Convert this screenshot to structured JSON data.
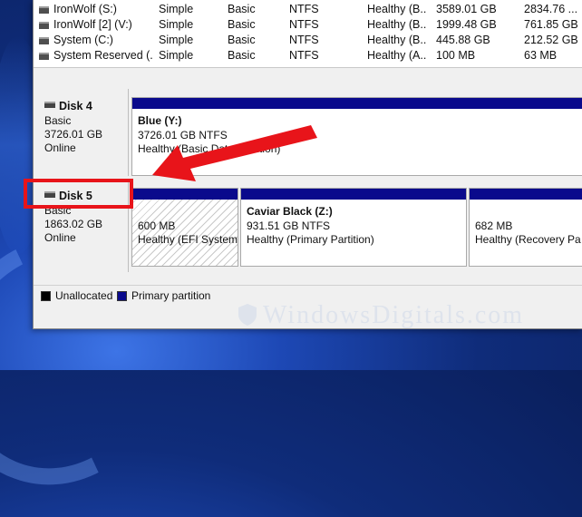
{
  "volumes": [
    {
      "name": "IronWolf (S:)",
      "layout": "Simple",
      "type": "Basic",
      "fs": "NTFS",
      "status": "Healthy (B...",
      "capacity": "3589.01 GB",
      "free": "2834.76 ..."
    },
    {
      "name": "IronWolf [2] (V:)",
      "layout": "Simple",
      "type": "Basic",
      "fs": "NTFS",
      "status": "Healthy (B...",
      "capacity": "1999.48 GB",
      "free": "761.85 GB"
    },
    {
      "name": "System (C:)",
      "layout": "Simple",
      "type": "Basic",
      "fs": "NTFS",
      "status": "Healthy (B...",
      "capacity": "445.88 GB",
      "free": "212.52 GB"
    },
    {
      "name": "System Reserved (...",
      "layout": "Simple",
      "type": "Basic",
      "fs": "NTFS",
      "status": "Healthy (A...",
      "capacity": "100 MB",
      "free": "63 MB"
    }
  ],
  "disks": [
    {
      "title": "Disk 4",
      "type": "Basic",
      "size": "3726.01 GB",
      "status": "Online",
      "partitions": [
        {
          "label": "Blue  (Y:)",
          "size": "3726.01 GB NTFS",
          "status": "Healthy (Basic Data Partition)"
        }
      ]
    },
    {
      "title": "Disk 5",
      "type": "Basic",
      "size": "1863.02 GB",
      "status": "Online",
      "partitions": [
        {
          "label": "",
          "size": "600 MB",
          "status": "Healthy (EFI System"
        },
        {
          "label": "Caviar Black  (Z:)",
          "size": "931.51 GB NTFS",
          "status": "Healthy (Primary Partition)"
        },
        {
          "label": "",
          "size": "682 MB",
          "status": "Healthy (Recovery Pa"
        }
      ]
    }
  ],
  "legend": {
    "unallocated": "Unallocated",
    "primary": "Primary partition"
  },
  "watermark": "WindowsDigitals.com",
  "colors": {
    "partition_bar": "#0a0a8c",
    "unallocated": "#000000",
    "annotation": "#e8141a"
  }
}
